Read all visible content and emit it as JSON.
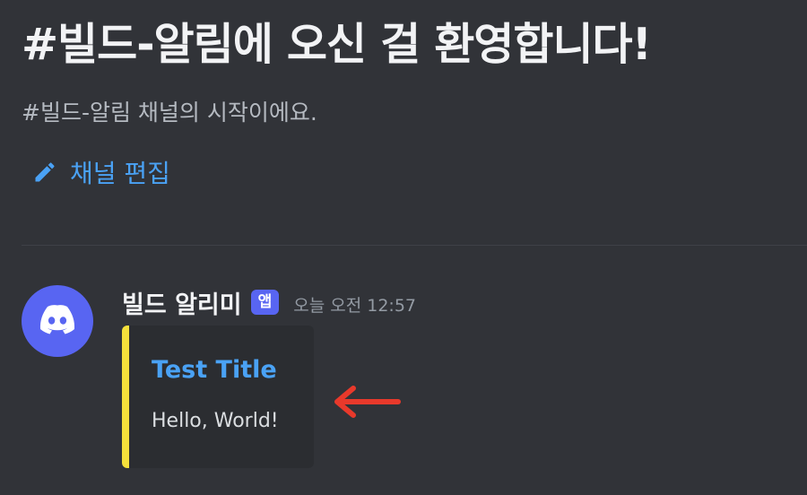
{
  "colors": {
    "background": "#313338",
    "link": "#4aa2f5",
    "brand": "#5865f2",
    "embed_accent": "#f5e03b",
    "annotation": "#e8392b"
  },
  "welcome": {
    "title": "#빌드-알림에 오신 걸 환영합니다!",
    "subtitle": "#빌드-알림 채널의 시작이에요.",
    "edit_label": "채널 편집",
    "edit_icon": "pencil-icon"
  },
  "message": {
    "avatar_icon": "discord-logo-icon",
    "username": "빌드 알리미",
    "badge": "앱",
    "timestamp": "오늘 오전 12:57",
    "embed": {
      "title": "Test Title",
      "description": "Hello, World!"
    }
  },
  "annotation": {
    "icon": "left-arrow-icon"
  }
}
